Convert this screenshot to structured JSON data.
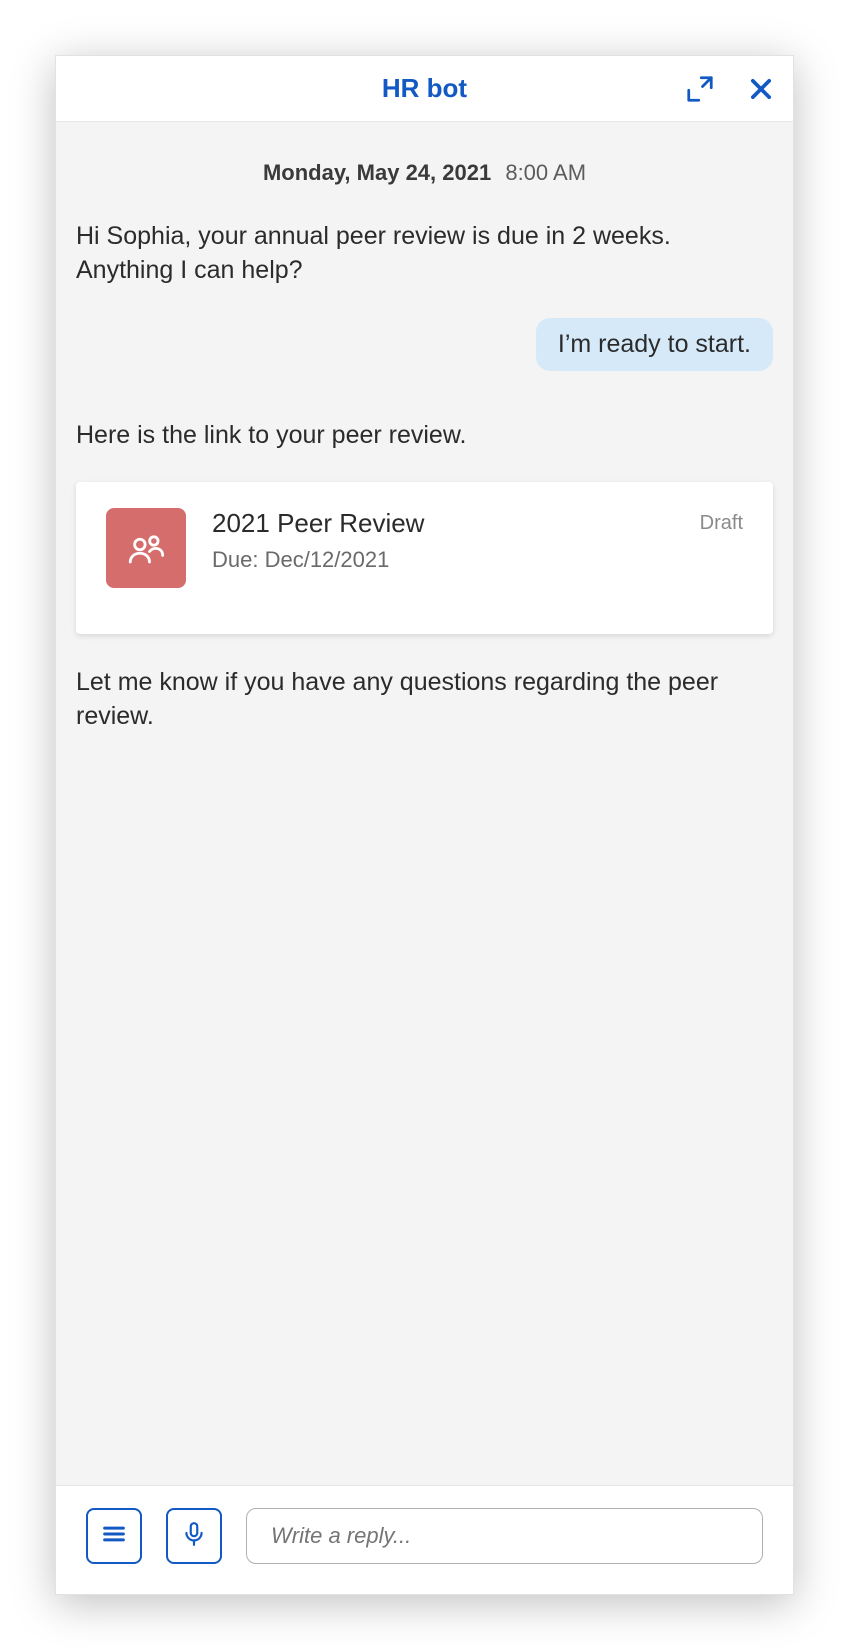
{
  "header": {
    "title": "HR bot"
  },
  "timestamp": {
    "date": "Monday, May 24, 2021",
    "time": "8:00 AM"
  },
  "messages": {
    "bot_intro": "Hi Sophia, your annual peer review is due in 2 weeks. Anything I can help?",
    "user_reply": "I’m ready to start.",
    "bot_link_intro": "Here is the link to your peer review.",
    "bot_followup": "Let me know if you have any questions regarding the peer review."
  },
  "card": {
    "title": "2021 Peer Review",
    "status": "Draft",
    "due": "Due: Dec/12/2021"
  },
  "footer": {
    "placeholder": "Write a reply..."
  }
}
